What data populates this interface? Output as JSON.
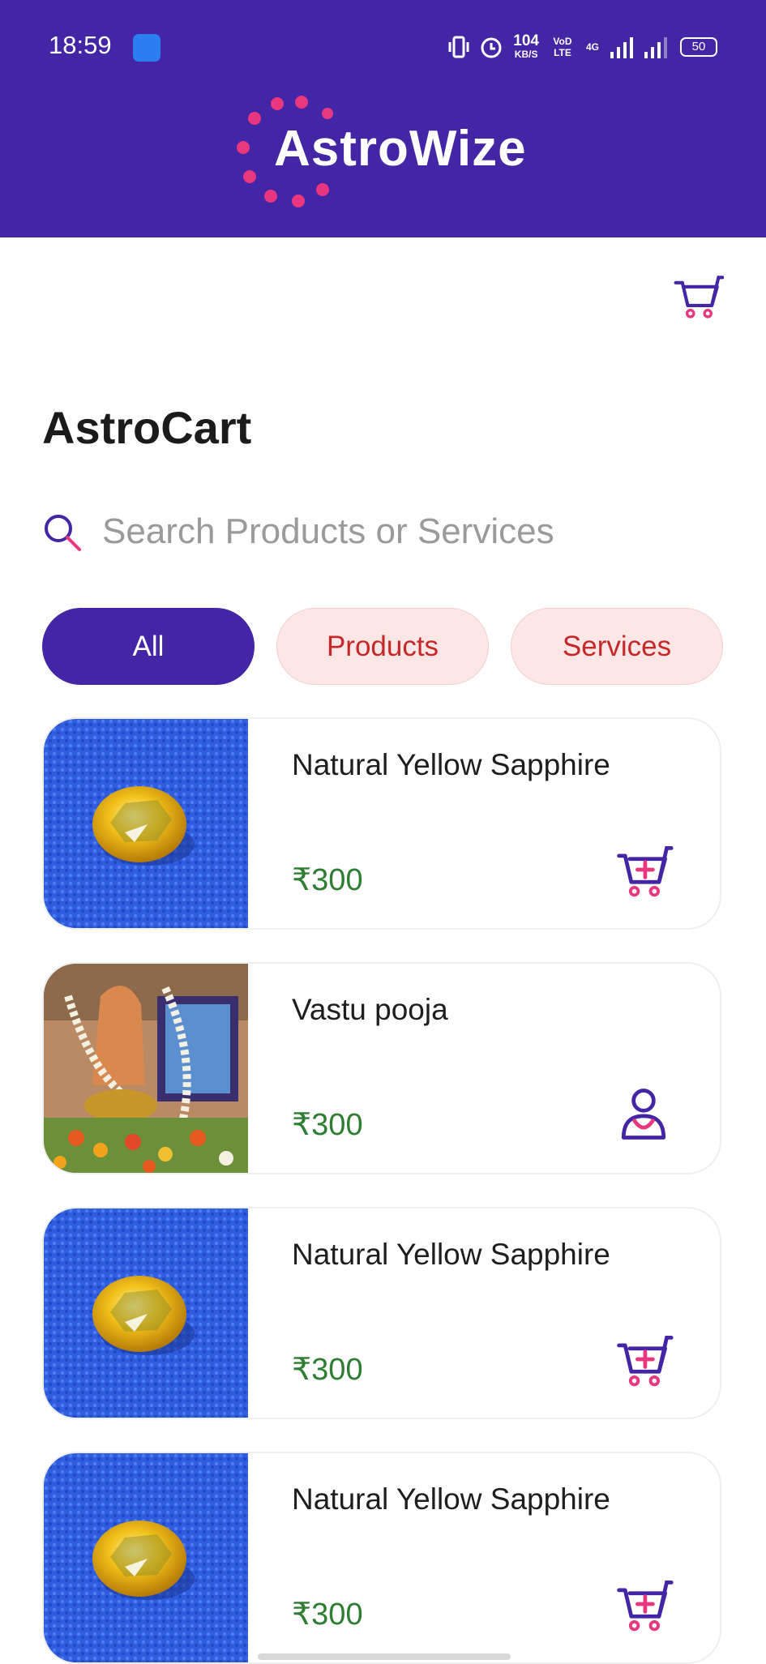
{
  "status_bar": {
    "time": "18:59",
    "speed_value": "104",
    "speed_unit": "KB/S",
    "volte": "VoD LTE",
    "network": "4G",
    "battery": "50"
  },
  "header": {
    "brand": "AstroWize",
    "background_color": "#4325a5",
    "dot_color": "#e8367f"
  },
  "page": {
    "title": "AstroCart"
  },
  "search": {
    "placeholder": "Search Products or Services",
    "value": ""
  },
  "filters": [
    {
      "label": "All",
      "active": true
    },
    {
      "label": "Products",
      "active": false
    },
    {
      "label": "Services",
      "active": false
    }
  ],
  "items": [
    {
      "title": "Natural Yellow Sapphire",
      "price": "₹300",
      "image": "yellow-sapphire-image",
      "action_icon": "add-to-cart-icon"
    },
    {
      "title": "Vastu pooja",
      "price": "₹300",
      "image": "vastu-pooja-image",
      "action_icon": "person-icon"
    },
    {
      "title": "Natural Yellow Sapphire",
      "price": "₹300",
      "image": "yellow-sapphire-image",
      "action_icon": "add-to-cart-icon"
    },
    {
      "title": "Natural Yellow Sapphire",
      "price": "₹300",
      "image": "yellow-sapphire-image",
      "action_icon": "add-to-cart-icon"
    }
  ],
  "colors": {
    "primary": "#4325a5",
    "accent": "#e8367f",
    "price": "#2e7d32",
    "chip_inactive_bg": "#fde6e6",
    "chip_inactive_text": "#c62828"
  }
}
